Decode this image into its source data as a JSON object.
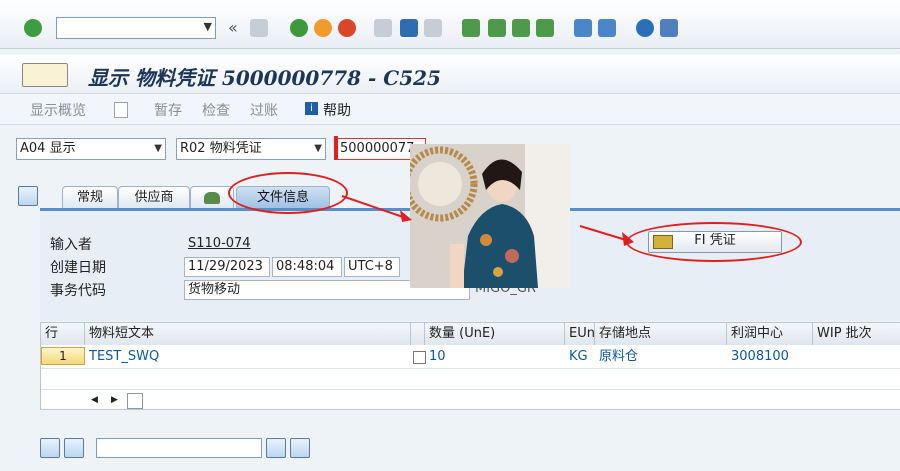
{
  "title": "显示 物料凭证 5000000778 - C525",
  "app_toolbar": {
    "overview": "显示概览",
    "save": "暂存",
    "check": "检查",
    "post": "过账",
    "help": "帮助"
  },
  "selectors": {
    "action": "A04 显示",
    "reference": "R02 物料凭证",
    "doc_number": "500000077"
  },
  "tabs": [
    "常规",
    "供应商",
    "文件信息"
  ],
  "file_info": {
    "entered_by_label": "输入者",
    "entered_by": "S110-074",
    "created_label": "创建日期",
    "created_date": "11/29/2023",
    "created_time": "08:48:04",
    "timezone": "UTC+8",
    "tcode_label": "事务代码",
    "tcode": "货物移动",
    "partial_text": "MIGO_GR"
  },
  "fi_button": "FI 凭证",
  "table": {
    "headers": [
      "行",
      "物料短文本",
      "",
      "数量 (UnE)",
      "EUn",
      "存储地点",
      "利润中心",
      "WIP 批次"
    ],
    "rows": [
      {
        "line": "1",
        "material": "TEST_SWQ",
        "qty": "10",
        "unit": "KG",
        "storage": "原料仓",
        "profit_center": "3008100"
      }
    ]
  },
  "colors": {
    "annotation": "#e02020",
    "link_blue": "#0b58a8",
    "tab_active": "#9ec0e4"
  }
}
